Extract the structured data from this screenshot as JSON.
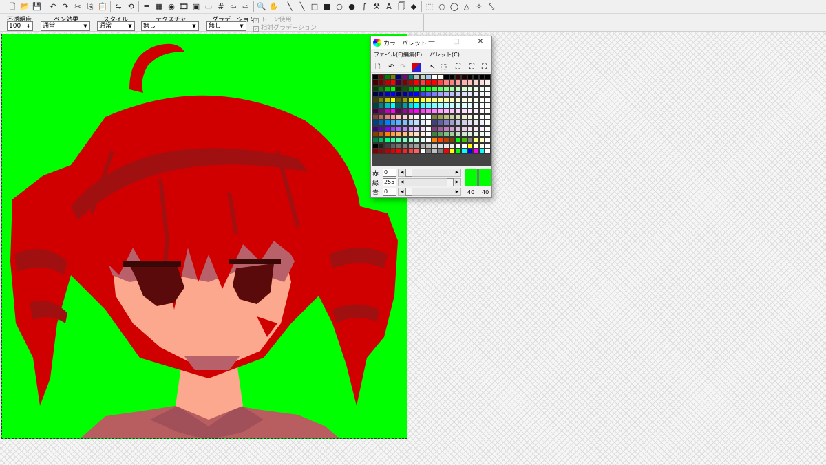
{
  "toolbar": {
    "icons": [
      "new-file-icon",
      "open-folder-icon",
      "save-icon",
      "undo-icon",
      "redo-icon",
      "cut-icon",
      "copy-icon",
      "paste-icon",
      "flip-icon",
      "rotate-icon",
      "line-width-icon",
      "pattern-icon",
      "color-picker-icon",
      "film-icon",
      "frame-icon",
      "screen-icon",
      "grid-icon",
      "left-arrow-icon",
      "right-arrow-icon",
      "zoom-icon",
      "hand-icon",
      "pen-icon",
      "line-icon",
      "rect-icon",
      "filled-rect-icon",
      "circle-icon",
      "filled-circle-icon",
      "curve-icon",
      "hammer-icon",
      "text-icon",
      "bucket-icon",
      "fill-icon",
      "select-rect-icon",
      "select-circle-icon",
      "lasso-icon",
      "polygon-select-icon",
      "magic-icon",
      "transform-icon"
    ]
  },
  "options": {
    "opacity_label": "不透明度",
    "opacity_value": "100",
    "pen_effect_label": "ペン効果",
    "pen_effect_value": "通常",
    "style_label": "スタイル",
    "style_value": "通常",
    "texture_label": "テクスチャ",
    "texture_value": "無し",
    "gradation_label": "グラデーション",
    "gradation_value": "無し",
    "tone_label": "トーン使用",
    "relative_gradation_label": "相対グラデーション"
  },
  "canvas": {
    "background_color": "#00ff00"
  },
  "palette": {
    "title": "カラーパレット",
    "minimize": "—",
    "maximize": "□",
    "close": "✕",
    "menu": [
      "ファイル(F)",
      "編集(E)",
      "パレット(C)"
    ],
    "swatch_colors": [
      [
        "#000000",
        "#800000",
        "#008000",
        "#808000",
        "#000080",
        "#800080",
        "#008080",
        "#c0c0c0",
        "#c0dcc0",
        "#a6caf0",
        "#ffffff",
        "#fffbf0",
        "#000000",
        "#000000",
        "#400000",
        "#200000",
        "#000000",
        "#000000",
        "#000000",
        "#000000"
      ],
      [
        "#400000",
        "#800000",
        "#c00000",
        "#ff0000",
        "#400040",
        "#800000",
        "#c00000",
        "#ff0000",
        "#ff4040",
        "#ff0000",
        "#ff0000",
        "#ff4040",
        "#ff8080",
        "#ff8080",
        "#ffa0a0",
        "#ffb0b0",
        "#ffc0c0",
        "#ffd0d0",
        "#ffe0e0",
        "#fff0f0"
      ],
      [
        "#004000",
        "#008000",
        "#00c000",
        "#00ff00",
        "#003000",
        "#006000",
        "#00a000",
        "#00d000",
        "#00ff00",
        "#00ff00",
        "#40ff40",
        "#60ff60",
        "#80ff80",
        "#a0ffa0",
        "#c0ffc0",
        "#d0ffd0",
        "#e0ffe0",
        "#e8ffe8",
        "#f0fff0",
        "#ffffff"
      ],
      [
        "#000040",
        "#000080",
        "#0000c0",
        "#0000ff",
        "#000060",
        "#0000a0",
        "#0000e0",
        "#0000ff",
        "#4040ff",
        "#6060ff",
        "#8080ff",
        "#a0a0ff",
        "#b0b0ff",
        "#c0c0ff",
        "#d0d0ff",
        "#e0e0ff",
        "#e8e8ff",
        "#f0f0ff",
        "#f8f8ff",
        "#ffffff"
      ],
      [
        "#404000",
        "#808000",
        "#c0c000",
        "#ffff00",
        "#606000",
        "#a0a000",
        "#e0e000",
        "#ffff00",
        "#ffff40",
        "#ffff60",
        "#ffff80",
        "#ffffa0",
        "#ffffb0",
        "#ffffc0",
        "#ffffd0",
        "#ffffe0",
        "#ffffe8",
        "#fffff0",
        "#fffff8",
        "#ffffff"
      ],
      [
        "#004040",
        "#008080",
        "#00c0c0",
        "#00ffff",
        "#006060",
        "#00a0a0",
        "#00e0e0",
        "#00ffff",
        "#40ffff",
        "#60ffff",
        "#80ffff",
        "#a0ffff",
        "#b0ffff",
        "#c0ffff",
        "#d0ffff",
        "#e0ffff",
        "#e8ffff",
        "#f0ffff",
        "#f8ffff",
        "#ffffff"
      ],
      [
        "#400040",
        "#800080",
        "#c000c0",
        "#ff00ff",
        "#600060",
        "#a000a0",
        "#e000e0",
        "#ff00ff",
        "#ff40ff",
        "#ff60ff",
        "#ff80ff",
        "#ffa0ff",
        "#ffb0ff",
        "#ffc0ff",
        "#ffd0ff",
        "#ffe0ff",
        "#ffe8ff",
        "#fff0ff",
        "#fff8ff",
        "#ffffff"
      ],
      [
        "#804040",
        "#c06060",
        "#e08080",
        "#ffa0a0",
        "#ffc0c0",
        "#ffd0d0",
        "#ffe0e0",
        "#fff0f0",
        "#ffffff",
        "#ffffff",
        "#808040",
        "#a0a060",
        "#c0c080",
        "#d0d0a0",
        "#e0e0c0",
        "#f0f0d0",
        "#f8f8e0",
        "#fffff0",
        "#ffffff",
        "#ffffff"
      ],
      [
        "#004080",
        "#0060c0",
        "#0080ff",
        "#40a0ff",
        "#60b0ff",
        "#80c0ff",
        "#a0d0ff",
        "#c0e0ff",
        "#e0f0ff",
        "#ffffff",
        "#404080",
        "#6060a0",
        "#8080c0",
        "#a0a0d0",
        "#c0c0e0",
        "#d0d0e8",
        "#e0e0f0",
        "#e8e8f8",
        "#f0f0ff",
        "#ffffff"
      ],
      [
        "#400080",
        "#6000c0",
        "#8000ff",
        "#a040ff",
        "#b060ff",
        "#c080ff",
        "#d0a0ff",
        "#e0c0ff",
        "#f0e0ff",
        "#ffffff",
        "#804080",
        "#a060a0",
        "#c080c0",
        "#d0a0d0",
        "#e0c0e0",
        "#e8d0e8",
        "#f0e0f0",
        "#f8e8f8",
        "#fff0ff",
        "#ffffff"
      ],
      [
        "#804000",
        "#c06000",
        "#ff8000",
        "#ffa040",
        "#ffb060",
        "#ffc080",
        "#ffd0a0",
        "#ffe0c0",
        "#fff0e0",
        "#ffffff",
        "#408040",
        "#60a060",
        "#80c080",
        "#a0d0a0",
        "#c0e0c0",
        "#d0e8d0",
        "#e0f0e0",
        "#e8f8e8",
        "#f0fff0",
        "#ffffff"
      ],
      [
        "#008040",
        "#00c060",
        "#00ff80",
        "#40ffa0",
        "#60ffb0",
        "#80ffc0",
        "#a0ffd0",
        "#c0ffe0",
        "#e0fff0",
        "#ffffff",
        "#ff8000",
        "#ff4000",
        "#c04000",
        "#804000",
        "#00ff00",
        "#40c000",
        "#808080",
        "#ffff80",
        "#ffffc0",
        "#ffffff"
      ],
      [
        "#000000",
        "#202020",
        "#404040",
        "#606060",
        "#707070",
        "#808080",
        "#909090",
        "#a0a0a0",
        "#b0b0b0",
        "#c0c0c0",
        "#d0d0d0",
        "#e0e0e0",
        "#e8e8e8",
        "#f0f0f0",
        "#f8f8f8",
        "#ffffff",
        "#ffff00",
        "#ffffe0",
        "#fffff0",
        "#ffffff"
      ],
      [
        "#800000",
        "#a00000",
        "#c00000",
        "#e00000",
        "#ff0000",
        "#ff2020",
        "#ff4040",
        "#ff6060",
        "#ffffff",
        "#808080",
        "#c0c0c0",
        "#808080",
        "#ff0000",
        "#ffff00",
        "#00ff00",
        "#00ffff",
        "#0000ff",
        "#ff00ff",
        "#00ffff",
        "#ffffff"
      ]
    ],
    "selected_swatch": {
      "row": 2,
      "col": 9
    },
    "red_label": "赤",
    "green_label": "緑",
    "blue_label": "青",
    "red_value": "0",
    "green_value": "255",
    "blue_value": "0",
    "red_level": 0,
    "green_level": 1,
    "blue_level": 0,
    "current_color": "#00ff00",
    "width_value": "40",
    "height_value": "40"
  }
}
